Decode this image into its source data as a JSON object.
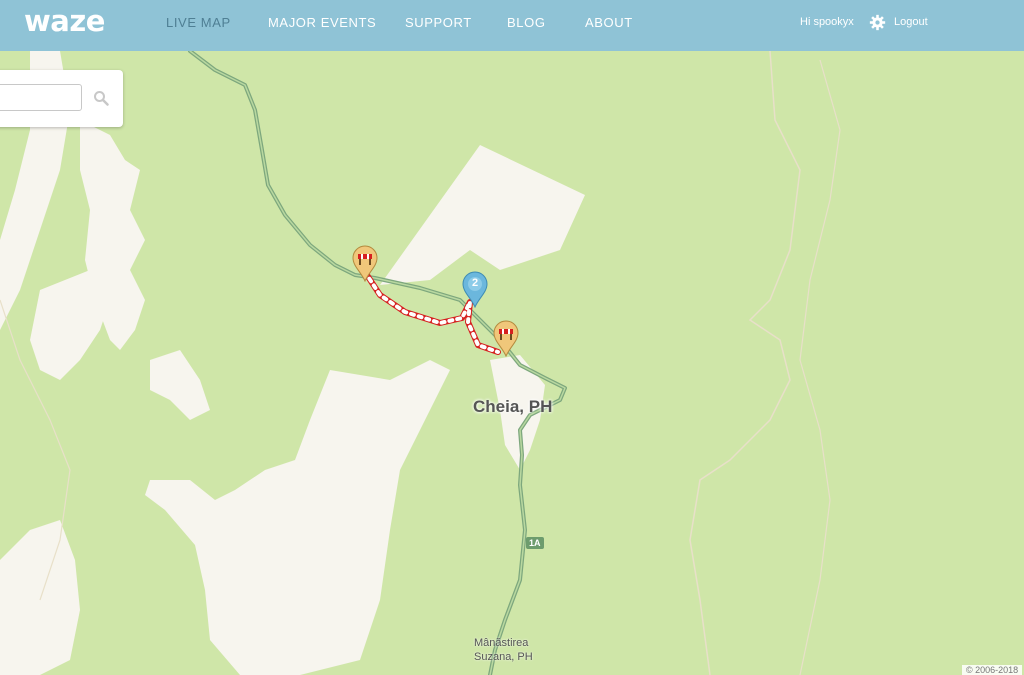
{
  "header": {
    "logo": "waze",
    "nav": [
      {
        "label": "LIVE MAP",
        "active": true
      },
      {
        "label": "MAJOR EVENTS"
      },
      {
        "label": "SUPPORT"
      },
      {
        "label": "BLOG"
      },
      {
        "label": "ABOUT"
      }
    ],
    "greeting": "Hi spookyx",
    "logout": "Logout"
  },
  "search": {
    "value": "",
    "placeholder": ""
  },
  "map": {
    "places": {
      "main": "Cheia, PH",
      "secondary_line1": "Mânăstirea",
      "secondary_line2": "Suzana, PH"
    },
    "road_shield": "1A",
    "cluster_count": "2",
    "copyright": "© 2006-2018"
  },
  "colors": {
    "header_bg": "#8fc3d6",
    "forest": "#cfe6a8",
    "clearing": "#f7f5ee",
    "road": "#7da77d",
    "closure_red": "#d62020",
    "pin_orange": "#f0c77a",
    "cluster_blue": "#6bb7dd"
  },
  "icons": [
    "gear-icon",
    "search-icon",
    "road-closure-icon"
  ]
}
